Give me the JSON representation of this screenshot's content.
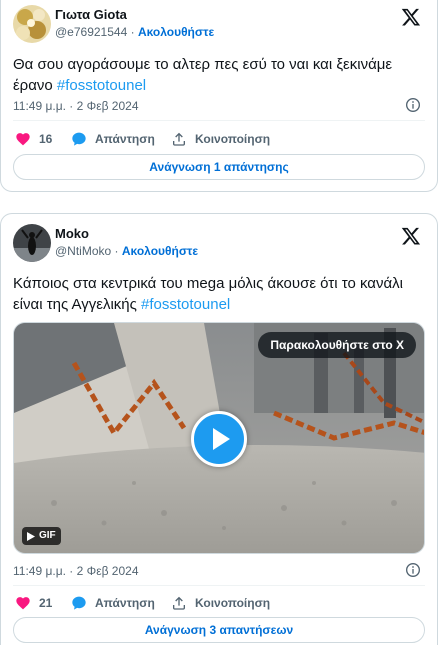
{
  "tweets": [
    {
      "user": {
        "name": "Γιωτα Giota",
        "handle": "@e76921544",
        "follow_label": "Ακολουθήστε"
      },
      "text": "Θα σου αγοράσουμε το αλτερ πες εσύ το ναι και ξεκινάμε έρανο ",
      "hashtag": "#fosstotounel",
      "timestamp": "11:49 μ.μ. · 2 Φεβ 2024",
      "likes": "16",
      "reply_label": "Απάντηση",
      "share_label": "Κοινοποίηση",
      "read_replies_label": "Ανάγνωση 1 απάντησης"
    },
    {
      "user": {
        "name": "Moko",
        "handle": "@NtiMoko",
        "follow_label": "Ακολουθήστε"
      },
      "text": "Κάποιος στα κεντρικά του mega μόλις άκουσε ότι το κανάλι είναι της Αγγελικής ",
      "hashtag": "#fosstotounel",
      "media": {
        "watch_label": "Παρακολουθήστε στο X",
        "badge": "GIF"
      },
      "timestamp": "11:49 μ.μ. · 2 Φεβ 2024",
      "likes": "21",
      "reply_label": "Απάντηση",
      "share_label": "Κοινοποίηση",
      "read_replies_label": "Ανάγνωση 3 απαντήσεων"
    }
  ],
  "colors": {
    "accent": "#1d9bf0",
    "link": "#006fd6",
    "like": "#f91880",
    "muted": "#536471"
  }
}
